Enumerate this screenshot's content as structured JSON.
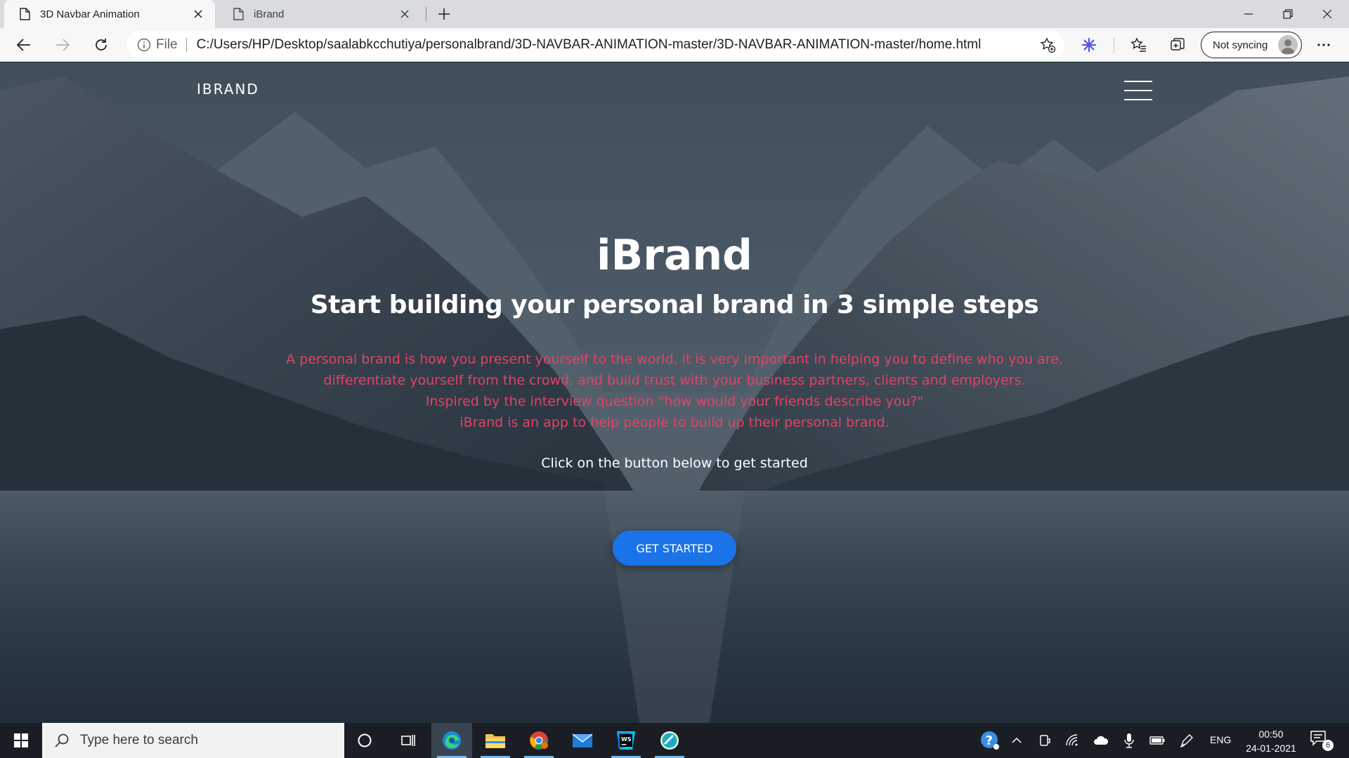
{
  "browser": {
    "tabs": [
      {
        "title": "3D Navbar Animation",
        "active": true
      },
      {
        "title": "iBrand",
        "active": false
      }
    ],
    "address": {
      "scheme_label": "File",
      "url": "C:/Users/HP/Desktop/saalabkcchutiya/personalbrand/3D-NAVBAR-ANIMATION-master/3D-NAVBAR-ANIMATION-master/home.html"
    },
    "profile": {
      "sync_label": "Not syncing"
    }
  },
  "page": {
    "logo": "IBRAND",
    "hero": {
      "title": "iBrand",
      "subtitle": "Start building your personal brand in 3 simple steps",
      "description": [
        "A personal brand is how you present yourself to the world, it is very important in helping you to define who you are,",
        "differentiate yourself from the crowd, and build trust with your business partners, clients and employers.",
        "Inspired by the interview question \"how would your friends describe you?\"",
        "iBrand is an app to help people to build up their personal brand."
      ],
      "cta_text": "Click on the button below to get started",
      "cta_button": "GET STARTED"
    },
    "colors": {
      "description_text": "#e0436a",
      "cta_button": "#1a73e8"
    }
  },
  "taskbar": {
    "search_placeholder": "Type here to search",
    "apps": [
      "cortana-icon",
      "task-view-icon",
      "edge-icon",
      "file-explorer-icon",
      "chrome-icon",
      "mail-icon",
      "webstorm-icon",
      "app-icon"
    ],
    "tray": {
      "language": "ENG",
      "time": "00:50",
      "date": "24-01-2021",
      "notification_count": "6"
    }
  }
}
